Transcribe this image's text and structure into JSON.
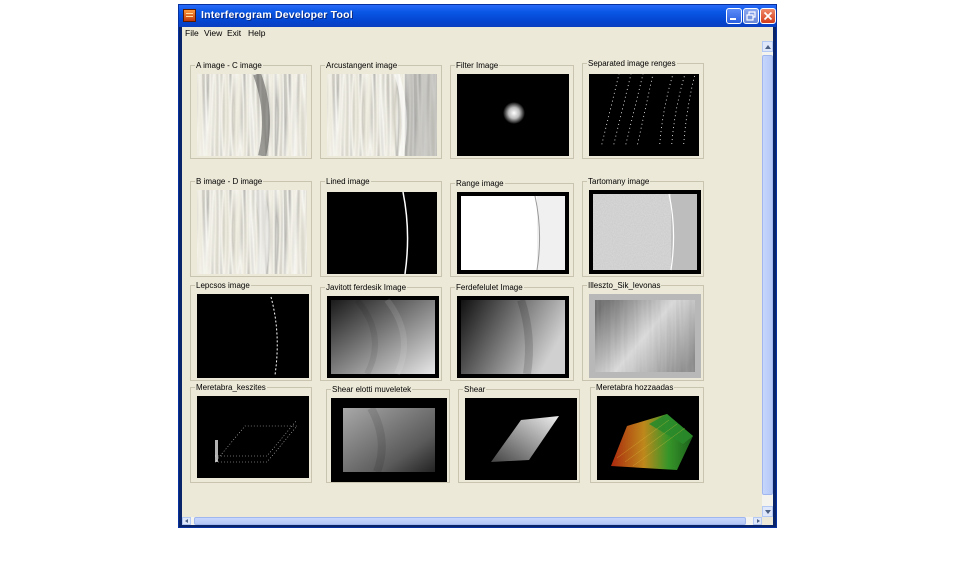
{
  "window": {
    "title": "Interferogram  Developer Tool",
    "controls": {
      "minimize": "minimize-icon",
      "restore": "restore-icon",
      "close": "close-icon"
    }
  },
  "menu": [
    {
      "label": "File"
    },
    {
      "label": "View"
    },
    {
      "label": "Exit"
    },
    {
      "label": "Help"
    }
  ],
  "panels": [
    {
      "label": "A image - C image"
    },
    {
      "label": "Arcustangent image"
    },
    {
      "label": "Filter Image"
    },
    {
      "label": "Separated  image renges"
    },
    {
      "label": "B image - D image"
    },
    {
      "label": "Lined image"
    },
    {
      "label": "Range image"
    },
    {
      "label": "Tartomany image"
    },
    {
      "label": "Lepcsos    image"
    },
    {
      "label": "Javitott ferdesik Image"
    },
    {
      "label": "Ferdefelulet Image"
    },
    {
      "label": "Illeszto_Sik_levonas"
    },
    {
      "label": "Meretabra_keszites"
    },
    {
      "label": "Shear elotti muveletek"
    },
    {
      "label": "Shear"
    },
    {
      "label": "Meretabra hozzaadas"
    }
  ],
  "colors": {
    "titlebar": "#0b58e6",
    "client_bg": "#ece9d8",
    "scrollbar_thumb": "#c6d6fc"
  }
}
